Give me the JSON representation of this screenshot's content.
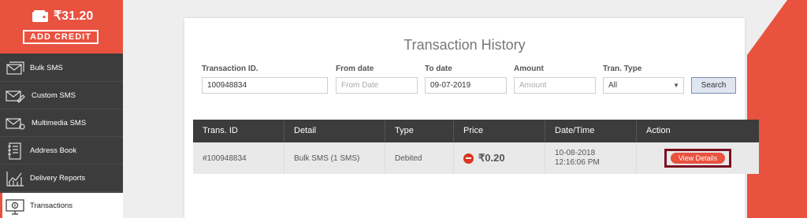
{
  "colors": {
    "accent": "#e8523f",
    "sidebar": "#3c3c3c",
    "highlight": "#7a1020"
  },
  "wallet": {
    "balance": "₹31.20",
    "add_credit_label": "ADD CREDIT"
  },
  "sidebar": {
    "items": [
      {
        "label": "Bulk SMS",
        "icon": "envelope-stack-icon"
      },
      {
        "label": "Custom SMS",
        "icon": "envelope-edit-icon"
      },
      {
        "label": "Multimedia SMS",
        "icon": "envelope-media-icon"
      },
      {
        "label": "Address Book",
        "icon": "address-book-icon"
      },
      {
        "label": "Delivery Reports",
        "icon": "line-chart-icon"
      },
      {
        "label": "Transactions",
        "icon": "transactions-monitor-icon"
      }
    ],
    "active": "Transactions"
  },
  "page": {
    "title": "Transaction History"
  },
  "filters": {
    "transaction_id": {
      "label": "Transaction ID.",
      "value": "100948834",
      "placeholder": ""
    },
    "from_date": {
      "label": "From date",
      "value": "",
      "placeholder": "From Date"
    },
    "to_date": {
      "label": "To date",
      "value": "09-07-2019",
      "placeholder": ""
    },
    "amount": {
      "label": "Amount",
      "value": "",
      "placeholder": "Amount"
    },
    "tran_type": {
      "label": "Tran. Type",
      "selected": "All"
    },
    "search_label": "Search"
  },
  "table": {
    "headers": [
      "Trans. ID",
      "Detail",
      "Type",
      "Price",
      "Date/Time",
      "Action"
    ],
    "rows": [
      {
        "trans_id": "#100948834",
        "detail": "Bulk SMS (1 SMS)",
        "type": "Debited",
        "price": "₹0.20",
        "date": "10-08-2018",
        "time": "12:16:06 PM",
        "action_label": "View Details"
      }
    ]
  }
}
